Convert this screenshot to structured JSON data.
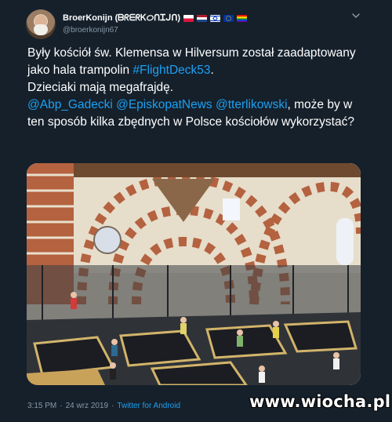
{
  "tweet": {
    "display_name": "BroerKonijn (ᗷᖇᗴᖇᏦᝪᑎᏆᒍᑎ)",
    "handle": "@broerkonijn67",
    "flags": [
      "poland-flag",
      "netherlands-flag",
      "israel-flag",
      "eu-flag",
      "rainbow-flag"
    ],
    "line1": "Były kościół św. Klemensa w Hilversum został zaadaptowany jako hala trampolin ",
    "hashtag": "#FlightDeck53",
    "line2_end": ".",
    "line3": "Dzieciaki mają megafrajdę.",
    "mention1": "@Abp_Gadecki",
    "mention2": "@EpiskopatNews",
    "mention3": "@tterlikowski",
    "line4": ", może by w ten sposób kilka zbędnych w Polsce kościołów wykorzystać?",
    "time": "3:15 PM",
    "sep1": "·",
    "date": "24 wrz 2019",
    "sep2": "·",
    "source": "Twitter for Android"
  },
  "image": {
    "description_icon": "photo-church-trampoline-park"
  },
  "watermark": "www.wiocha.pl",
  "colors": {
    "background": "#15202b",
    "link": "#1da1f2",
    "secondary_text": "#8899a6",
    "primary_text": "#ffffff"
  }
}
